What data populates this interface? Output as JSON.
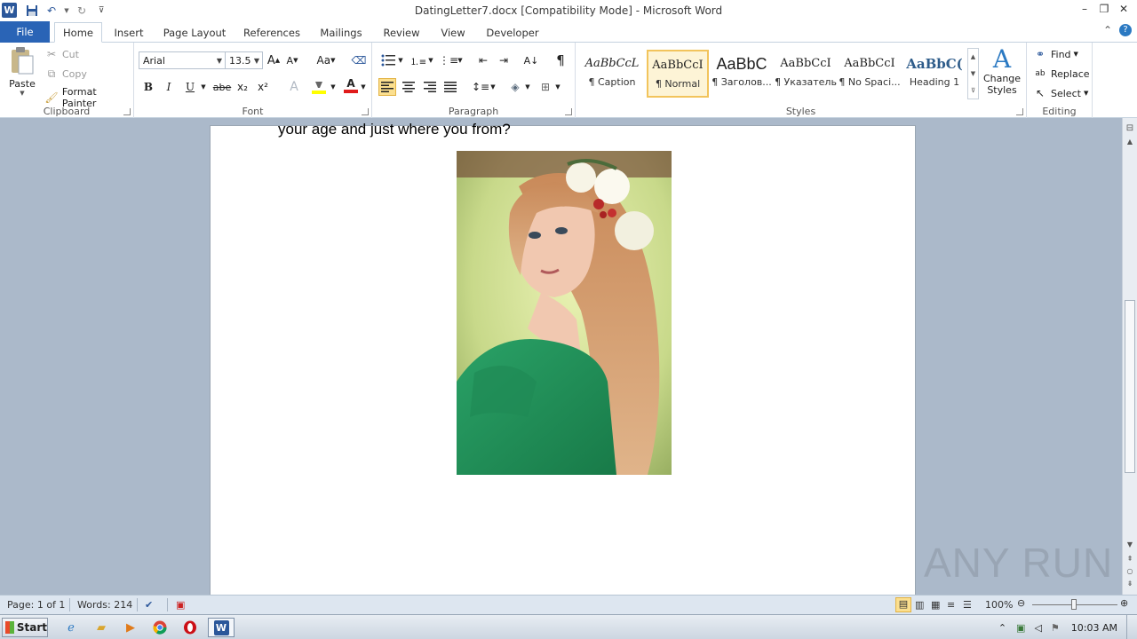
{
  "window": {
    "title": "DatingLetter7.docx [Compatibility Mode] - Microsoft Word",
    "word_logo": "W",
    "controls": {
      "minimize": "–",
      "restore": "❐",
      "close": "✕"
    },
    "doc_controls": {
      "minimize": "–",
      "restore": "❐",
      "close": "✕"
    }
  },
  "tabs": {
    "file": "File",
    "items": [
      {
        "label": "Home"
      },
      {
        "label": "Insert"
      },
      {
        "label": "Page Layout"
      },
      {
        "label": "References"
      },
      {
        "label": "Mailings"
      },
      {
        "label": "Review"
      },
      {
        "label": "View"
      },
      {
        "label": "Developer"
      }
    ],
    "active": "Home"
  },
  "clipboard": {
    "paste": "Paste",
    "cut": "Cut",
    "copy": "Copy",
    "format_painter": "Format Painter",
    "label": "Clipboard"
  },
  "font": {
    "name": "Arial",
    "size": "13.5",
    "label": "Font",
    "bold": "B",
    "italic": "I",
    "underline": "U",
    "strike": "abe",
    "subscript": "x₂",
    "superscript": "x²",
    "grow": "A",
    "shrink": "A",
    "case": "Aa",
    "font_color": "A",
    "text_effects": "A"
  },
  "paragraph": {
    "label": "Paragraph",
    "pilcrow": "¶"
  },
  "styles": {
    "label": "Styles",
    "items": [
      {
        "sample": "AaBbCcL",
        "name": "¶ Caption"
      },
      {
        "sample": "AaBbCcI",
        "name": "¶ Normal"
      },
      {
        "sample": "AaBbC",
        "name": "¶ Заголов..."
      },
      {
        "sample": "AaBbCcI",
        "name": "¶ Указатель"
      },
      {
        "sample": "AaBbCcI",
        "name": "¶ No Spaci..."
      },
      {
        "sample": "AaBbC(",
        "name": "Heading 1"
      }
    ],
    "selected_index": 1,
    "change_styles_1": "Change",
    "change_styles_2": "Styles"
  },
  "editing": {
    "label": "Editing",
    "find": "Find",
    "replace": "Replace",
    "select": "Select"
  },
  "document": {
    "text_line": "your age and just where you from?"
  },
  "status": {
    "page": "Page: 1 of 1",
    "words": "Words: 214",
    "zoom": "100%"
  },
  "taskbar": {
    "start": "Start",
    "clock": "10:03 AM"
  },
  "watermark": "ANY RUN"
}
